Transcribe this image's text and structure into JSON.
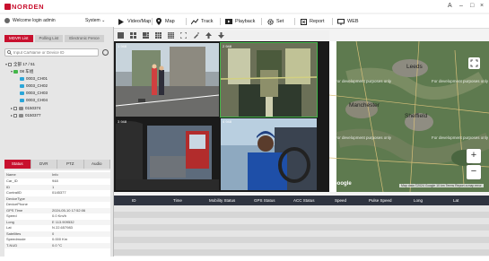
{
  "app": {
    "brand": "NORDEN",
    "window_controls": [
      "A",
      "–",
      "□",
      "×"
    ]
  },
  "user": {
    "welcome": "Welcome login admin",
    "system": "System"
  },
  "toolbar": {
    "items": [
      {
        "label": "Video/Map",
        "icon": "play-icon"
      },
      {
        "label": "Map",
        "icon": "map-pin-icon"
      },
      {
        "label": "Track",
        "icon": "track-icon"
      },
      {
        "label": "Playback",
        "icon": "playback-icon"
      },
      {
        "label": "Set",
        "icon": "gear-icon"
      },
      {
        "label": "Report",
        "icon": "report-icon"
      },
      {
        "label": "WEB",
        "icon": "monitor-icon"
      }
    ]
  },
  "left": {
    "tabs": [
      "MDVR List",
      "Polling List",
      "Electronic Fence"
    ],
    "search_placeholder": "Input CarName or Device ID",
    "tree": {
      "root": "全部 17 / 51",
      "group": "08 车组",
      "channels": [
        "0003_CH01",
        "0003_CH02",
        "0003_CH03",
        "0003_CH04"
      ],
      "devices": [
        "0150374",
        "0150377"
      ]
    },
    "bottom_tabs": [
      "Status",
      "DVR",
      "PTZ",
      "Audio"
    ],
    "info": {
      "header": {
        "k": "Name",
        "v": "Info"
      },
      "rows": [
        {
          "k": "Car_ID",
          "v": "948"
        },
        {
          "k": "ID",
          "v": "1"
        },
        {
          "k": "ContralID",
          "v": "0145377"
        },
        {
          "k": "DeviceType",
          "v": ""
        },
        {
          "k": "DevicePhone",
          "v": ""
        },
        {
          "k": "GPS Time",
          "v": "2024-05-10 17:52:06"
        },
        {
          "k": "Speed",
          "v": "0.0 Km/h"
        },
        {
          "k": "Long",
          "v": "E 113.909532"
        },
        {
          "k": "Lat",
          "v": "N 22.657983"
        },
        {
          "k": "Satellites",
          "v": "0"
        },
        {
          "k": "Speedmode",
          "v": "0.000 Km"
        },
        {
          "k": "T-NUD",
          "v": "0.0 °C"
        }
      ]
    }
  },
  "video": {
    "tiles": [
      {
        "label": "1 948",
        "scene": "street"
      },
      {
        "label": "2 948",
        "scene": "bus"
      },
      {
        "label": "3 948",
        "scene": "mirror"
      },
      {
        "label": "4 948",
        "scene": "driver"
      }
    ]
  },
  "map": {
    "cities": [
      "Leeds",
      "Manchester",
      "Sheffield"
    ],
    "watermark": "For development purposes only",
    "google": "Google",
    "footer": "Map data ©2024 Google   10 km   Terms   Report a map error",
    "zoom_in": "+",
    "zoom_out": "−"
  },
  "table": {
    "columns": [
      "ID",
      "Time",
      "Mobility Status",
      "GPS Status",
      "ACC Status",
      "Speed",
      "Pulse Speed",
      "Long",
      "Lat"
    ]
  },
  "colors": {
    "brand": "#c8102e",
    "selected_tile": "#43b649",
    "table_header": "#2f3440"
  }
}
